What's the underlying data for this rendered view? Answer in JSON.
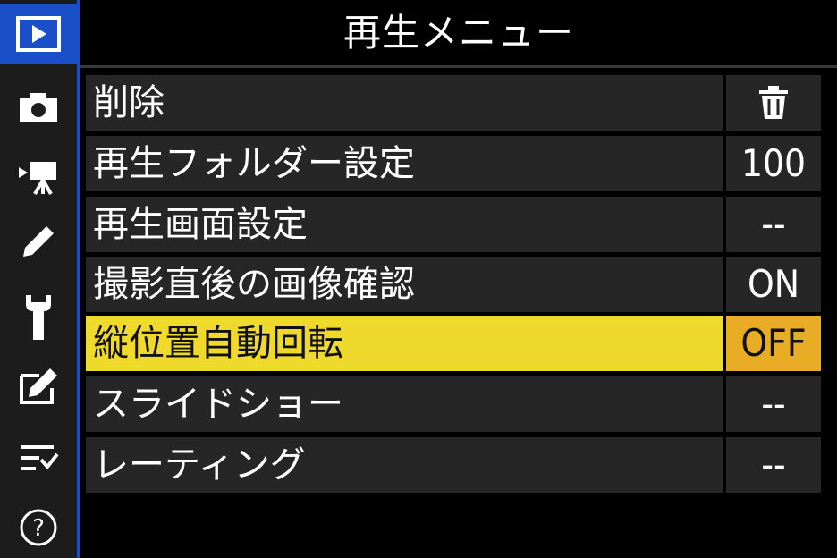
{
  "header": {
    "title": "再生メニュー"
  },
  "sidebar": {
    "items": [
      {
        "icon": "playback-icon",
        "active": true
      },
      {
        "icon": "camera-icon",
        "active": false
      },
      {
        "icon": "movie-camera-icon",
        "active": false
      },
      {
        "icon": "pencil-icon",
        "active": false
      },
      {
        "icon": "wrench-icon",
        "active": false
      },
      {
        "icon": "retouch-icon",
        "active": false
      },
      {
        "icon": "my-menu-icon",
        "active": false
      },
      {
        "icon": "help-icon",
        "active": false
      }
    ]
  },
  "menu": {
    "items": [
      {
        "label": "削除",
        "value": "",
        "value_icon": "trash-icon"
      },
      {
        "label": "再生フォルダー設定",
        "value": "100"
      },
      {
        "label": "再生画面設定",
        "value": "--"
      },
      {
        "label": "撮影直後の画像確認",
        "value": "ON"
      },
      {
        "label": "縦位置自動回転",
        "value": "OFF",
        "selected": true
      },
      {
        "label": "スライドショー",
        "value": "--"
      },
      {
        "label": "レーティング",
        "value": "--"
      }
    ]
  },
  "colors": {
    "accent_blue": "#1a4fc9",
    "highlight_yellow": "#f0d92d",
    "highlight_value": "#e9ac25",
    "row_bg": "#262626"
  }
}
